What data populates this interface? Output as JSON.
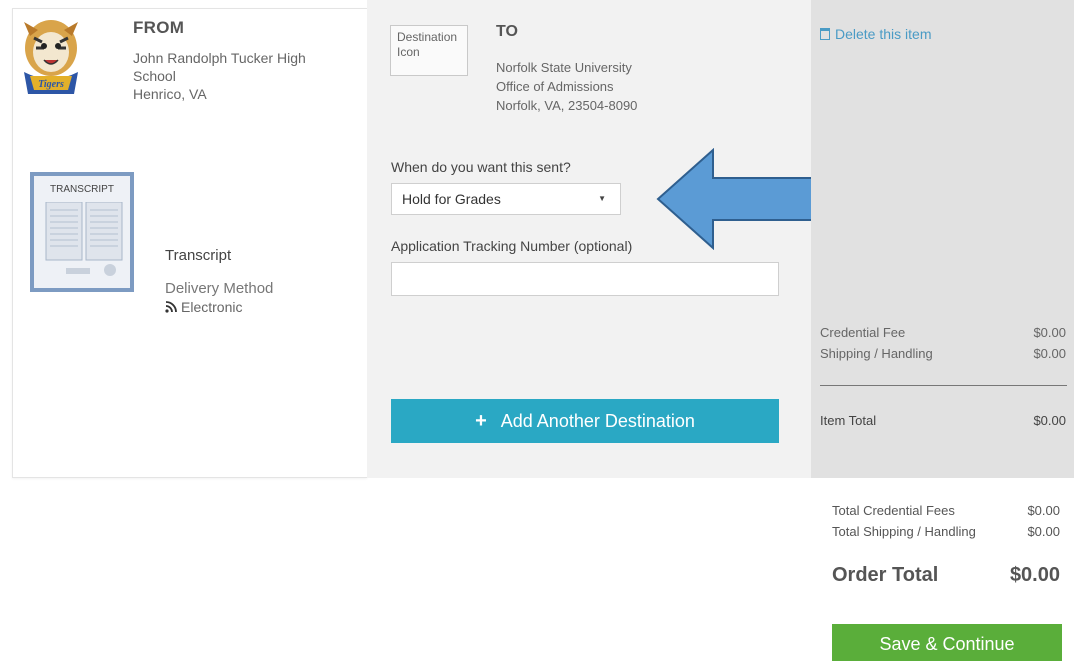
{
  "from": {
    "heading": "FROM",
    "school_line1": "John Randolph Tucker High",
    "school_line2": "School",
    "location": "Henrico, VA",
    "mascot_text": "Tigers"
  },
  "credential": {
    "thumbnail_title": "TRANSCRIPT",
    "title": "Transcript",
    "delivery_label": "Delivery Method",
    "delivery_value": "Electronic"
  },
  "to": {
    "dest_icon_alt": "Destination Icon",
    "heading": "TO",
    "line1": "Norfolk State University",
    "line2": "Office of Admissions",
    "line3": "Norfolk, VA, 23504-8090"
  },
  "form": {
    "when_label": "When do you want this sent?",
    "when_value": "Hold for Grades",
    "tracking_label": "Application Tracking Number (optional)",
    "tracking_value": "",
    "add_destination_label": "Add Another Destination"
  },
  "item": {
    "delete_label": "Delete this item",
    "credential_fee_label": "Credential Fee",
    "credential_fee_value": "$0.00",
    "shipping_label": "Shipping / Handling",
    "shipping_value": "$0.00",
    "item_total_label": "Item Total",
    "item_total_value": "$0.00"
  },
  "order": {
    "total_credential_label": "Total Credential Fees",
    "total_credential_value": "$0.00",
    "total_shipping_label": "Total Shipping / Handling",
    "total_shipping_value": "$0.00",
    "order_total_label": "Order Total",
    "order_total_value": "$0.00",
    "save_label": "Save & Continue"
  },
  "colors": {
    "accent_blue": "#2aa8c4",
    "save_green": "#5aae3a",
    "arrow_blue": "#5b9bd5",
    "link_blue": "#4a9bc5"
  }
}
